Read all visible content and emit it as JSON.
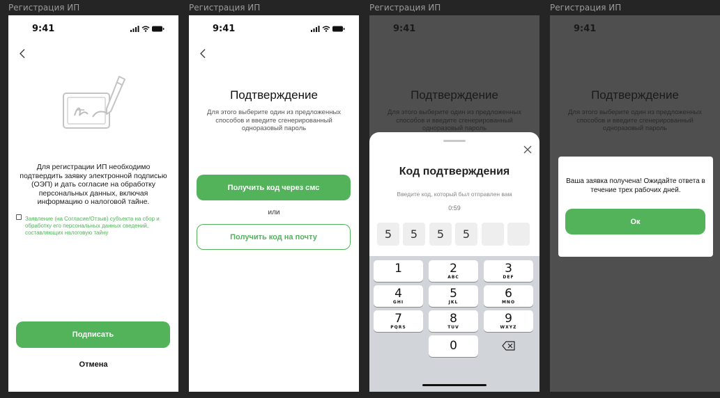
{
  "frames": [
    {
      "title": "Регистрация ИП"
    },
    {
      "title": "Регистрация ИП"
    },
    {
      "title": "Регистрация ИП"
    },
    {
      "title": "Регистрация ИП"
    }
  ],
  "status": {
    "time": "9:41"
  },
  "screen1": {
    "description": "Для регистрации ИП необходимо подтвердить заявку электронной подписью (ОЭП) и дать согласие на обработку персональных данных, включая информацию о налоговой тайне.",
    "consent_text": "Заявление (на Согласие/Отзыв) субъекта на сбор и обработку его персональных данных сведений, составляющих налоговую тайну",
    "sign_label": "Подписать",
    "cancel_label": "Отмена"
  },
  "screen2": {
    "title": "Подтверждение",
    "subtitle": "Для этого выберите один из предложенных способов и введите сгенерированный одноразовый пароль",
    "sms_label": "Получить код через смс",
    "or_label": "или",
    "email_label": "Получить код на почту"
  },
  "screen3": {
    "title": "Код подтверждения",
    "hint": "Введите код, который был отправлен вам",
    "timer": "0:59",
    "code": [
      "5",
      "5",
      "5",
      "5",
      "",
      ""
    ],
    "keys": [
      {
        "n": "1",
        "l": ""
      },
      {
        "n": "2",
        "l": "ABC"
      },
      {
        "n": "3",
        "l": "DEF"
      },
      {
        "n": "4",
        "l": "GHI"
      },
      {
        "n": "5",
        "l": "JKL"
      },
      {
        "n": "6",
        "l": "MNO"
      },
      {
        "n": "7",
        "l": "PQRS"
      },
      {
        "n": "8",
        "l": "TUV"
      },
      {
        "n": "9",
        "l": "WXYZ"
      },
      {
        "n": "0",
        "l": ""
      }
    ]
  },
  "screen4": {
    "message": "Ваша заявка  получена! Ожидайте ответа в течение трех рабочих дней.",
    "ok_label": "Ок"
  },
  "colors": {
    "accent": "#52b35a",
    "keypad_bg": "#d1d4d9",
    "dark_bg": "#252525"
  }
}
